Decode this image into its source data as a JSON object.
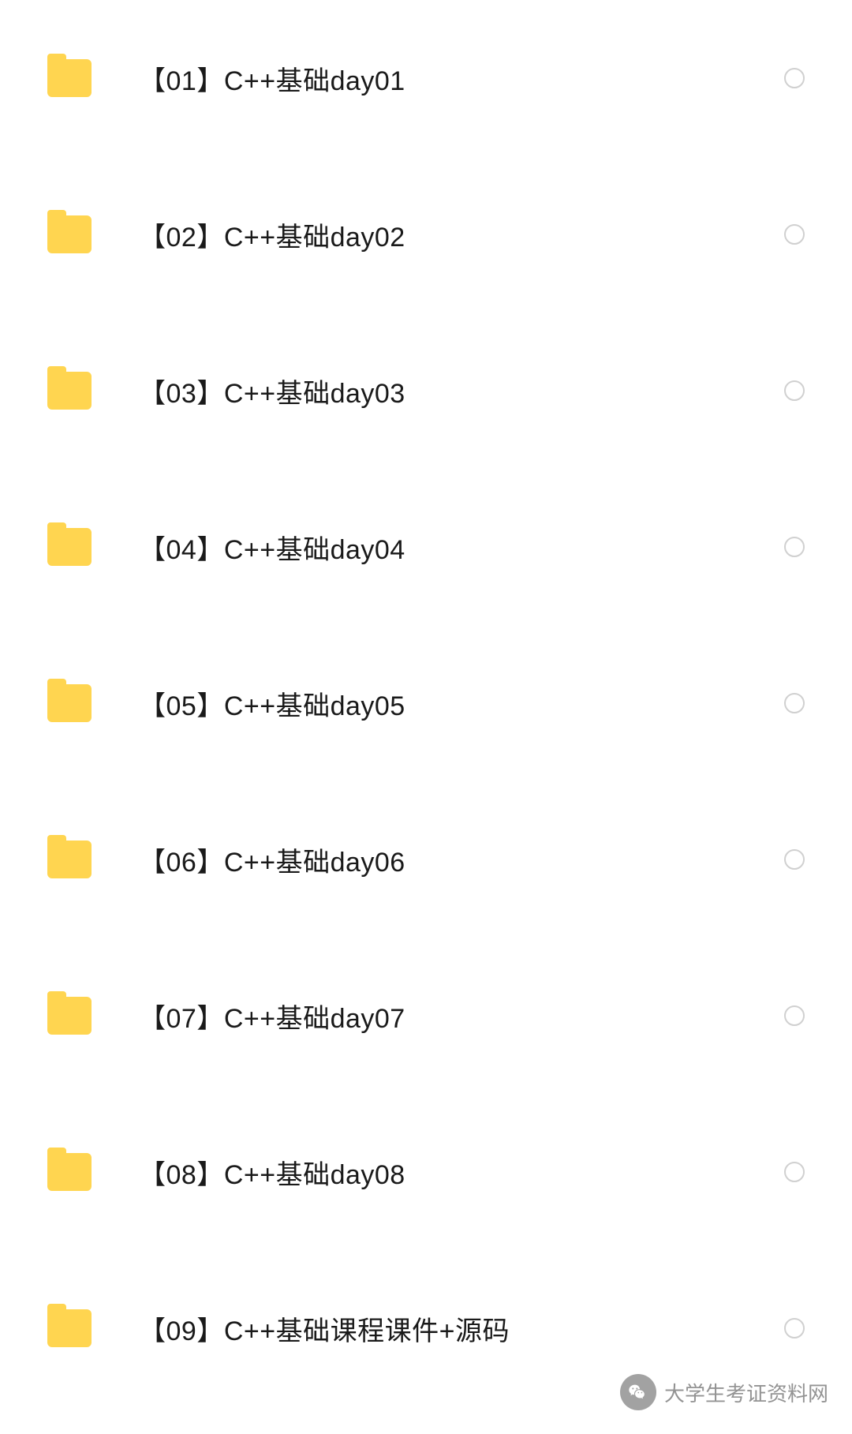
{
  "folders": [
    {
      "name": "【01】C++基础day01"
    },
    {
      "name": "【02】C++基础day02"
    },
    {
      "name": "【03】C++基础day03"
    },
    {
      "name": "【04】C++基础day04"
    },
    {
      "name": "【05】C++基础day05"
    },
    {
      "name": "【06】C++基础day06"
    },
    {
      "name": "【07】C++基础day07"
    },
    {
      "name": "【08】C++基础day08"
    },
    {
      "name": "【09】C++基础课程课件+源码"
    }
  ],
  "watermark": {
    "text": "大学生考证资料网"
  }
}
